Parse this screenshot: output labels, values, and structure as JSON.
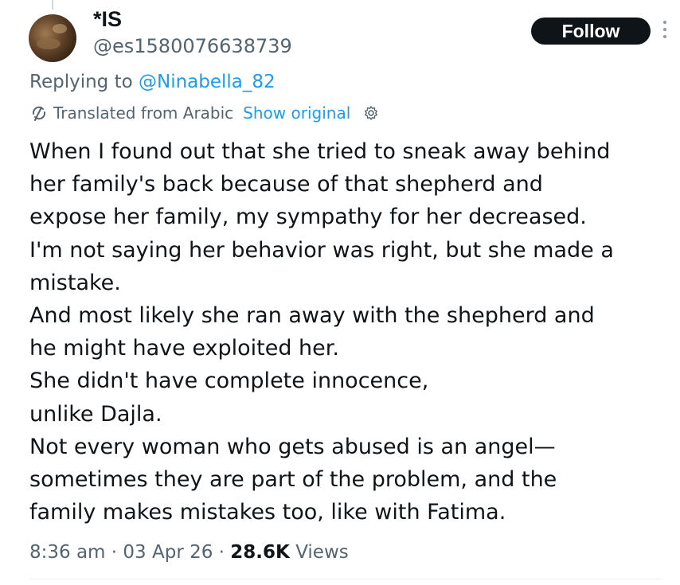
{
  "author": {
    "display_name": "*IS",
    "handle": "@es1580076638739"
  },
  "follow_label": "Follow",
  "reply": {
    "prefix": "Replying to ",
    "mention": "@Ninabella_82"
  },
  "translation": {
    "translated_label": "Translated from Arabic",
    "show_original_label": "Show original",
    "icon": "translate-icon",
    "settings_icon": "settings-icon"
  },
  "tweet_lines": [
    "When I found out that she tried to sneak away behind",
    "her family's back because of that shepherd and",
    "expose her family, my sympathy for her decreased.",
    "I'm not saying her behavior was right, but she made a",
    "mistake.",
    "And most likely she ran away with the shepherd and",
    "he might have exploited her.",
    "She didn't have complete innocence,",
    "unlike Dajla.",
    "Not every woman who gets abused is an angel—",
    "sometimes they are part of the problem, and the",
    "family makes mistakes too, like with Fatima."
  ],
  "meta": {
    "time": "8:36 am",
    "separator": "·",
    "date": "03 Apr 26",
    "views_count": "28.6K",
    "views_label": "Views"
  },
  "colors": {
    "text_primary": "#0f1419",
    "text_secondary": "#536471",
    "link": "#1d9bf0",
    "button_bg": "#0f1419"
  }
}
